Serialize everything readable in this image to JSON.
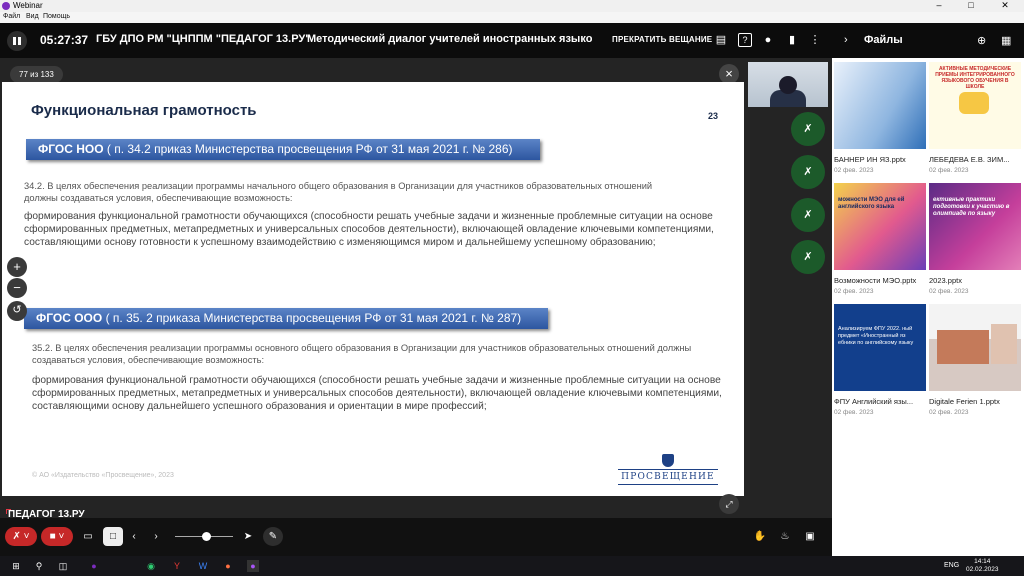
{
  "window": {
    "title": "Webinar",
    "controls": [
      "–",
      "□",
      "✕"
    ]
  },
  "menu": [
    "Файл",
    "Вид",
    "Помощь"
  ],
  "topbar": {
    "time": "05:27:37",
    "org": "ГБУ ДПО РМ \"ЦНППМ \"ПЕДАГОГ 13.РУ\"",
    "event_title": "Методический диалог учителей иностранных языков П",
    "stop_label": "ПРЕКРАТИТЬ ВЕЩАНИЕ"
  },
  "stage": {
    "counter": "77 из 133"
  },
  "slide": {
    "title": "Функциональная грамотность",
    "page": "23",
    "banner1_bold": "ФГОС НОО",
    "banner1_rest": " ( п. 34.2 приказ Министерства просвещения РФ от 31 мая 2021 г. № 286)",
    "p1_intro": "34.2. В целях обеспечения реализации программы начального общего образования в Организации для участников образовательных отношений должны создаваться условия, обеспечивающие возможность:",
    "p1_body": "формирования функциональной грамотности обучающихся (способности решать учебные задачи и жизненные проблемные ситуации на основе сформированных предметных, метапредметных и универсальных способов деятельности), включающей овладение ключевыми компетенциями, составляющими основу готовности к успешному взаимодействию с изменяющимся миром и дальнейшему успешному образованию;",
    "banner2_bold": "ФГОС ООО",
    "banner2_rest": " ( п. 35. 2 приказа Министерства просвещения РФ от 31 мая 2021 г. № 287)",
    "p2_intro": "35.2. В целях обеспечения реализации программы основного общего образования в Организации для участников образовательных отношений должны создаваться условия, обеспечивающие возможность:",
    "p2_body": "формирования функциональной грамотности обучающихся (способности решать учебные задачи и жизненные проблемные ситуации на основе сформированных предметных, метапредметных и универсальных способов деятельности), включающей овладение ключевыми компетенциями, составляющими основу дальнейшего успешного образования и ориентации в мире профессий;",
    "copyright": "© АО «Издательство «Просвещение», 2023",
    "publisher": "ПРОСВЕЩЕНИЕ"
  },
  "brand": "ПЕДАГОГ 13.РУ",
  "files_panel": {
    "title": "Файлы",
    "files": [
      {
        "name": "БАННЕР ИН ЯЗ.pptx",
        "date": "02 фев. 2023",
        "thumb_text": ""
      },
      {
        "name": "ЛЕБЕДЕВА Е.В. ЗИМ...",
        "date": "02 фев. 2023",
        "thumb_text": "АКТИВНЫЕ МЕТОДИЧЕСКИЕ ПРИЕМЫ ИНТЕГРИРОВАННОГО ЯЗЫКОВОГО ОБУЧЕНИЯ В ШКОЛЕ"
      },
      {
        "name": "Возможности МЭО.pptx",
        "date": "02 фев. 2023",
        "thumb_text": "можности МЭО для ей английского языка"
      },
      {
        "name": "2023.pptx",
        "date": "02 фев. 2023",
        "thumb_text": "ективные практики подготовки к участию в олимпиаде по языку"
      },
      {
        "name": "ФПУ Английский язы...",
        "date": "02 фев. 2023",
        "thumb_text": "Анализируем ФПУ 2022. ный предмет «Иностранный яз ебники по английскому языку"
      },
      {
        "name": "Digitale Ferien 1.pptx",
        "date": "02 фев. 2023",
        "thumb_text": ""
      }
    ]
  },
  "taskbar": {
    "lang": "ENG",
    "time": "14:14",
    "date": "02.02.2023"
  },
  "colors": {
    "mic_green": "#1c5a2a",
    "banner_blue": "#2d56a0",
    "accent_red": "#c62828"
  }
}
